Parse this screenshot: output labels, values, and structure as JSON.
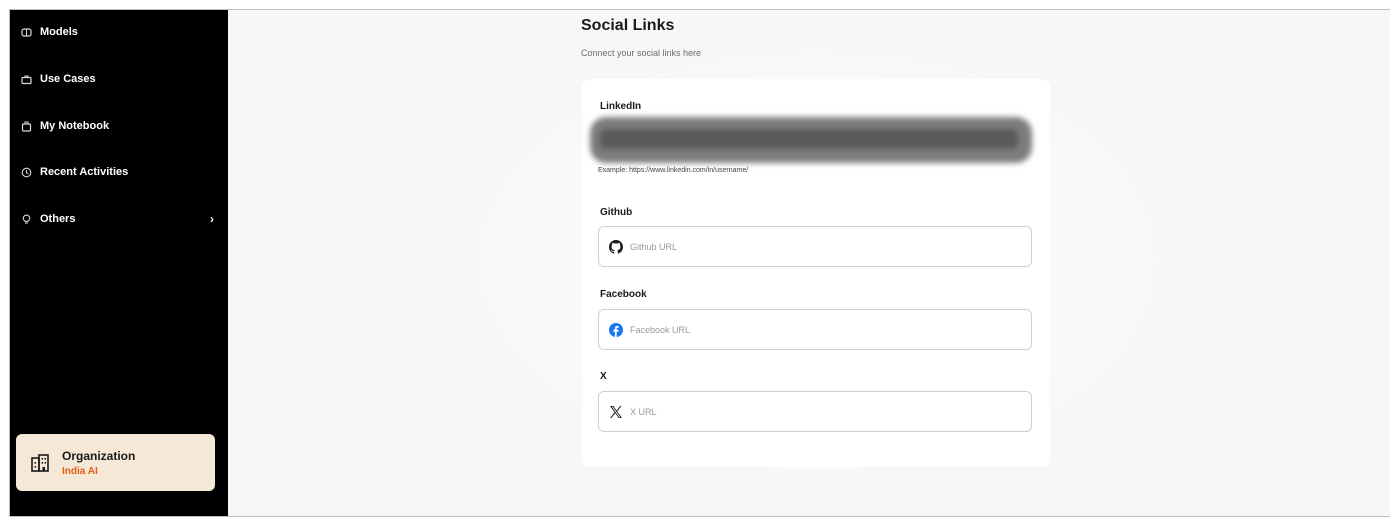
{
  "sidebar": {
    "items": [
      {
        "label": "Models",
        "icon": "models-icon"
      },
      {
        "label": "Use Cases",
        "icon": "use-cases-icon"
      },
      {
        "label": "My Notebook",
        "icon": "notebook-icon"
      },
      {
        "label": "Recent Activities",
        "icon": "clock-icon"
      },
      {
        "label": "Others",
        "icon": "bulb-icon",
        "chevron": "›"
      }
    ],
    "organization": {
      "title": "Organization",
      "name": "India AI",
      "icon": "building-icon",
      "accent": "#e25d12",
      "background": "#f6e8d6"
    }
  },
  "main": {
    "title": "Social Links",
    "subtitle": "Connect your social links here",
    "fields": {
      "linkedin": {
        "label": "LinkedIn",
        "value_redacted": true,
        "hint": "Example: https://www.linkedin.com/in/username/"
      },
      "github": {
        "label": "Github",
        "placeholder": "Github URL",
        "icon": "github-icon"
      },
      "facebook": {
        "label": "Facebook",
        "placeholder": "Facebook URL",
        "icon": "facebook-icon",
        "icon_color": "#1877f2"
      },
      "x": {
        "label": "X",
        "placeholder": "X URL",
        "icon": "x-logo-icon"
      }
    }
  }
}
